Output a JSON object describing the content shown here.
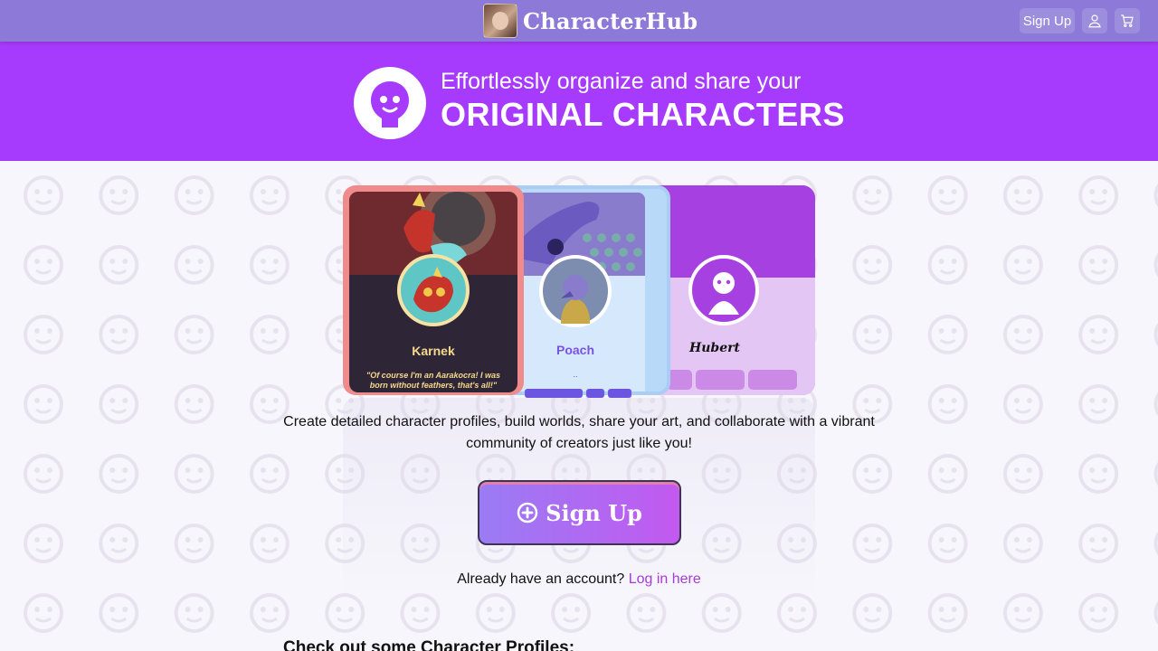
{
  "header": {
    "brand_name": "CharacterHub",
    "signup_label": "Sign Up",
    "account_icon": "user-icon",
    "cart_icon": "cart-icon"
  },
  "hero": {
    "tagline": "Effortlessly organize and share your",
    "headline": "ORIGINAL CHARACTERS",
    "logo_icon": "smiley-face-icon"
  },
  "cards": [
    {
      "name": "Karnek",
      "quote": "\"Of course I'm an Aarakocra! I was born without feathers, that's all!\"",
      "color": "#ef8b8b"
    },
    {
      "name": "Poach",
      "subtitle": "..",
      "color": "#b9d9f9"
    },
    {
      "name": "Hubert",
      "color": "#a23ed8"
    }
  ],
  "description": "Create detailed character profiles, build worlds, share your art, and collaborate with a vibrant community of creators just like you!",
  "cta": {
    "label": "Sign Up",
    "icon": "plus-circle-icon"
  },
  "login": {
    "prompt": "Already have an account?",
    "link": "Log in here"
  },
  "section_title": "Check out some Character Profiles:",
  "colors": {
    "topbar": "#8c79d8",
    "hero": "#a63bfd",
    "link": "#a63bd6"
  }
}
